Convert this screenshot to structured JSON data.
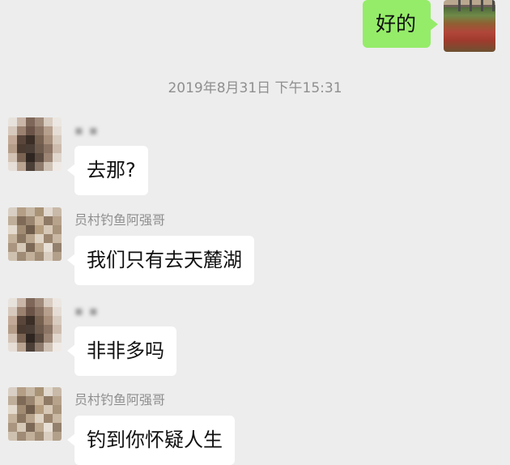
{
  "outgoing": {
    "text": "好的"
  },
  "timestamp": "2019年8月31日 下午15:31",
  "messages": [
    {
      "sender": "",
      "text": "去那?"
    },
    {
      "sender": "员村钓鱼阿强哥",
      "text": "我们只有去天麓湖"
    },
    {
      "sender": "",
      "text": "非非多吗"
    },
    {
      "sender": "员村钓鱼阿强哥",
      "text": "钓到你怀疑人生"
    }
  ],
  "colors": {
    "background": "#ededed",
    "outgoing_bubble": "#95ec69",
    "incoming_bubble": "#ffffff",
    "meta_text": "#8f8f8f"
  }
}
